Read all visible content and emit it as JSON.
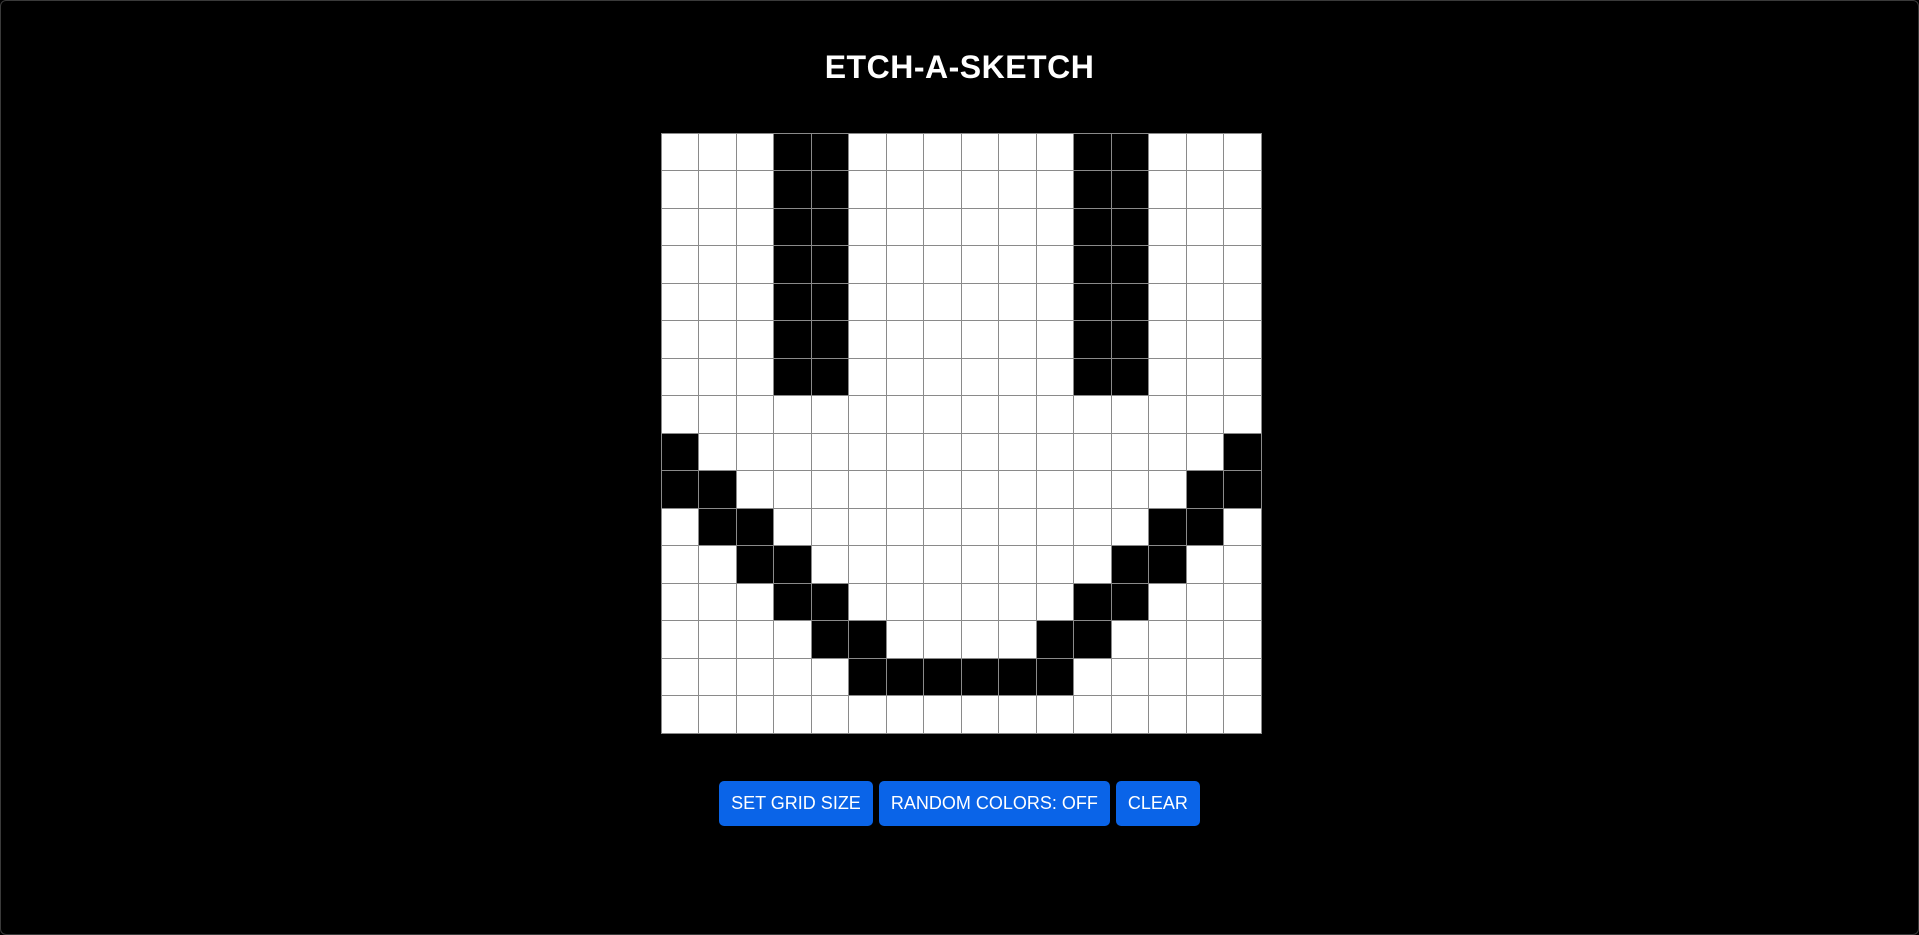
{
  "app": {
    "title": "ETCH-A-SKETCH"
  },
  "grid": {
    "size": 16,
    "cell_color_on": "#000000",
    "cell_color_off": "#ffffff",
    "border_color": "#8a8a8a",
    "rows": [
      "0001100000011000",
      "0001100000011000",
      "0001100000011000",
      "0001100000011000",
      "0001100000011000",
      "0001100000011000",
      "0001100000011000",
      "0000000000000000",
      "1000000000000001",
      "1100000000000011",
      "0110000000000110",
      "0011000000001100",
      "0001100000011000",
      "0000110000110000",
      "0000011111100000",
      "0000000000000000"
    ]
  },
  "controls": {
    "set_grid_size_label": "SET GRID SIZE",
    "random_colors_label": "RANDOM COLORS: OFF",
    "clear_label": "CLEAR",
    "accent_color": "#0a64e8"
  }
}
